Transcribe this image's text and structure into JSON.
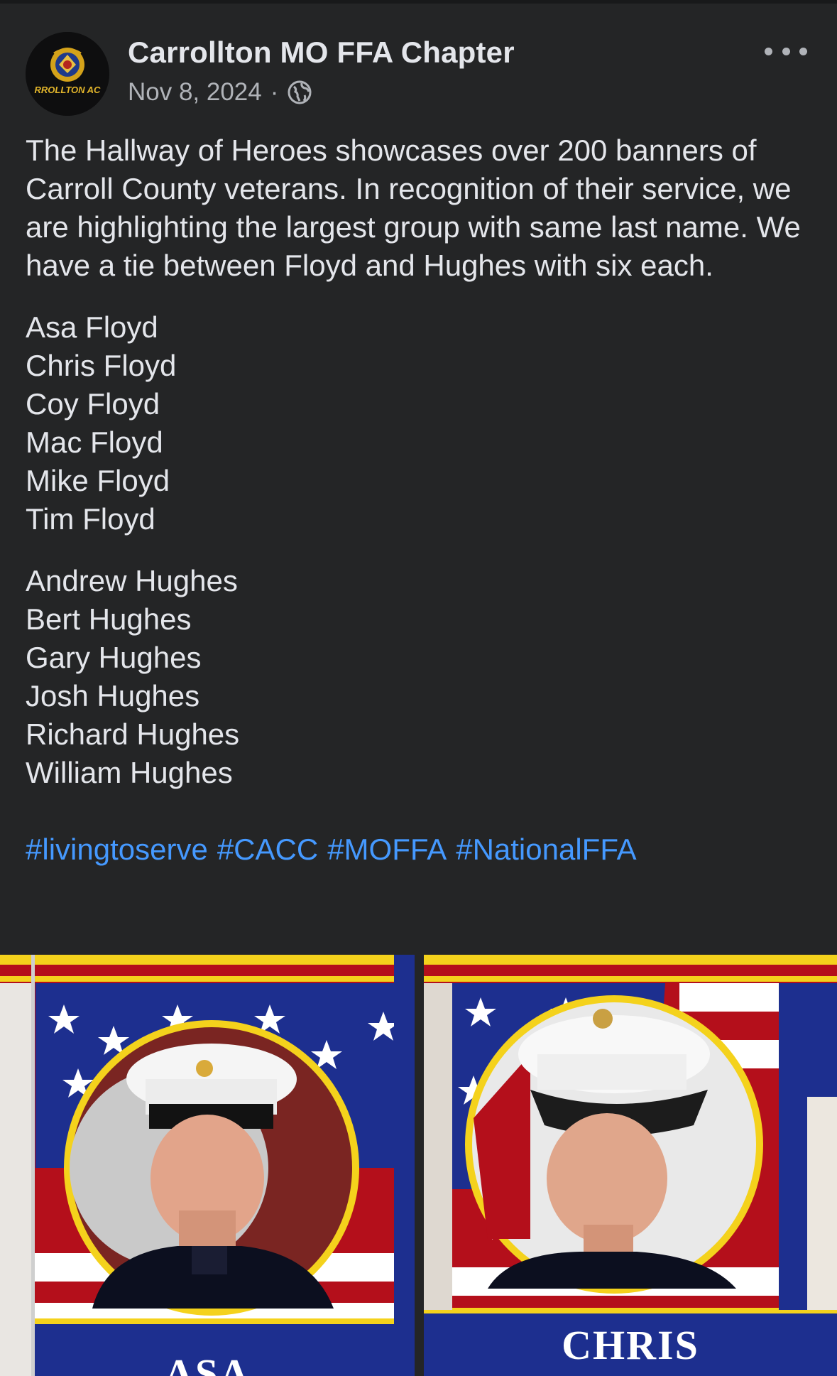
{
  "post": {
    "page_name": "Carrollton MO FFA Chapter",
    "date": "Nov 8, 2024",
    "separator": "·",
    "privacy_icon": "globe-icon",
    "more_icon": "more-options-icon",
    "avatar_text": "RROLLTON AC",
    "intro": "The Hallway of Heroes showcases over 200 banners of Carroll County veterans. In recognition of their service, we are highlighting the largest group with same last name. We have a tie between Floyd and Hughes with six each.",
    "floyd_names": [
      "Asa Floyd",
      "Chris Floyd",
      "Coy Floyd",
      "Mac Floyd",
      "Mike Floyd",
      "Tim Floyd"
    ],
    "hughes_names": [
      "Andrew Hughes",
      "Bert Hughes",
      "Gary Hughes",
      "Josh Hughes",
      "Richard Hughes",
      "William Hughes"
    ],
    "hashtags": [
      "#livingtoserve",
      "#CACC",
      "#MOFFA",
      "#NationalFFA"
    ]
  },
  "photos": [
    {
      "banner_name": "ASA"
    },
    {
      "banner_name": "CHRIS"
    }
  ],
  "colors": {
    "background": "#242526",
    "text": "#e4e6eb",
    "secondary_text": "#b0b3b8",
    "hashtag": "#4599ff",
    "banner_blue": "#1d2f8f",
    "banner_yellow": "#f4d21c",
    "banner_red": "#b40f1b"
  }
}
